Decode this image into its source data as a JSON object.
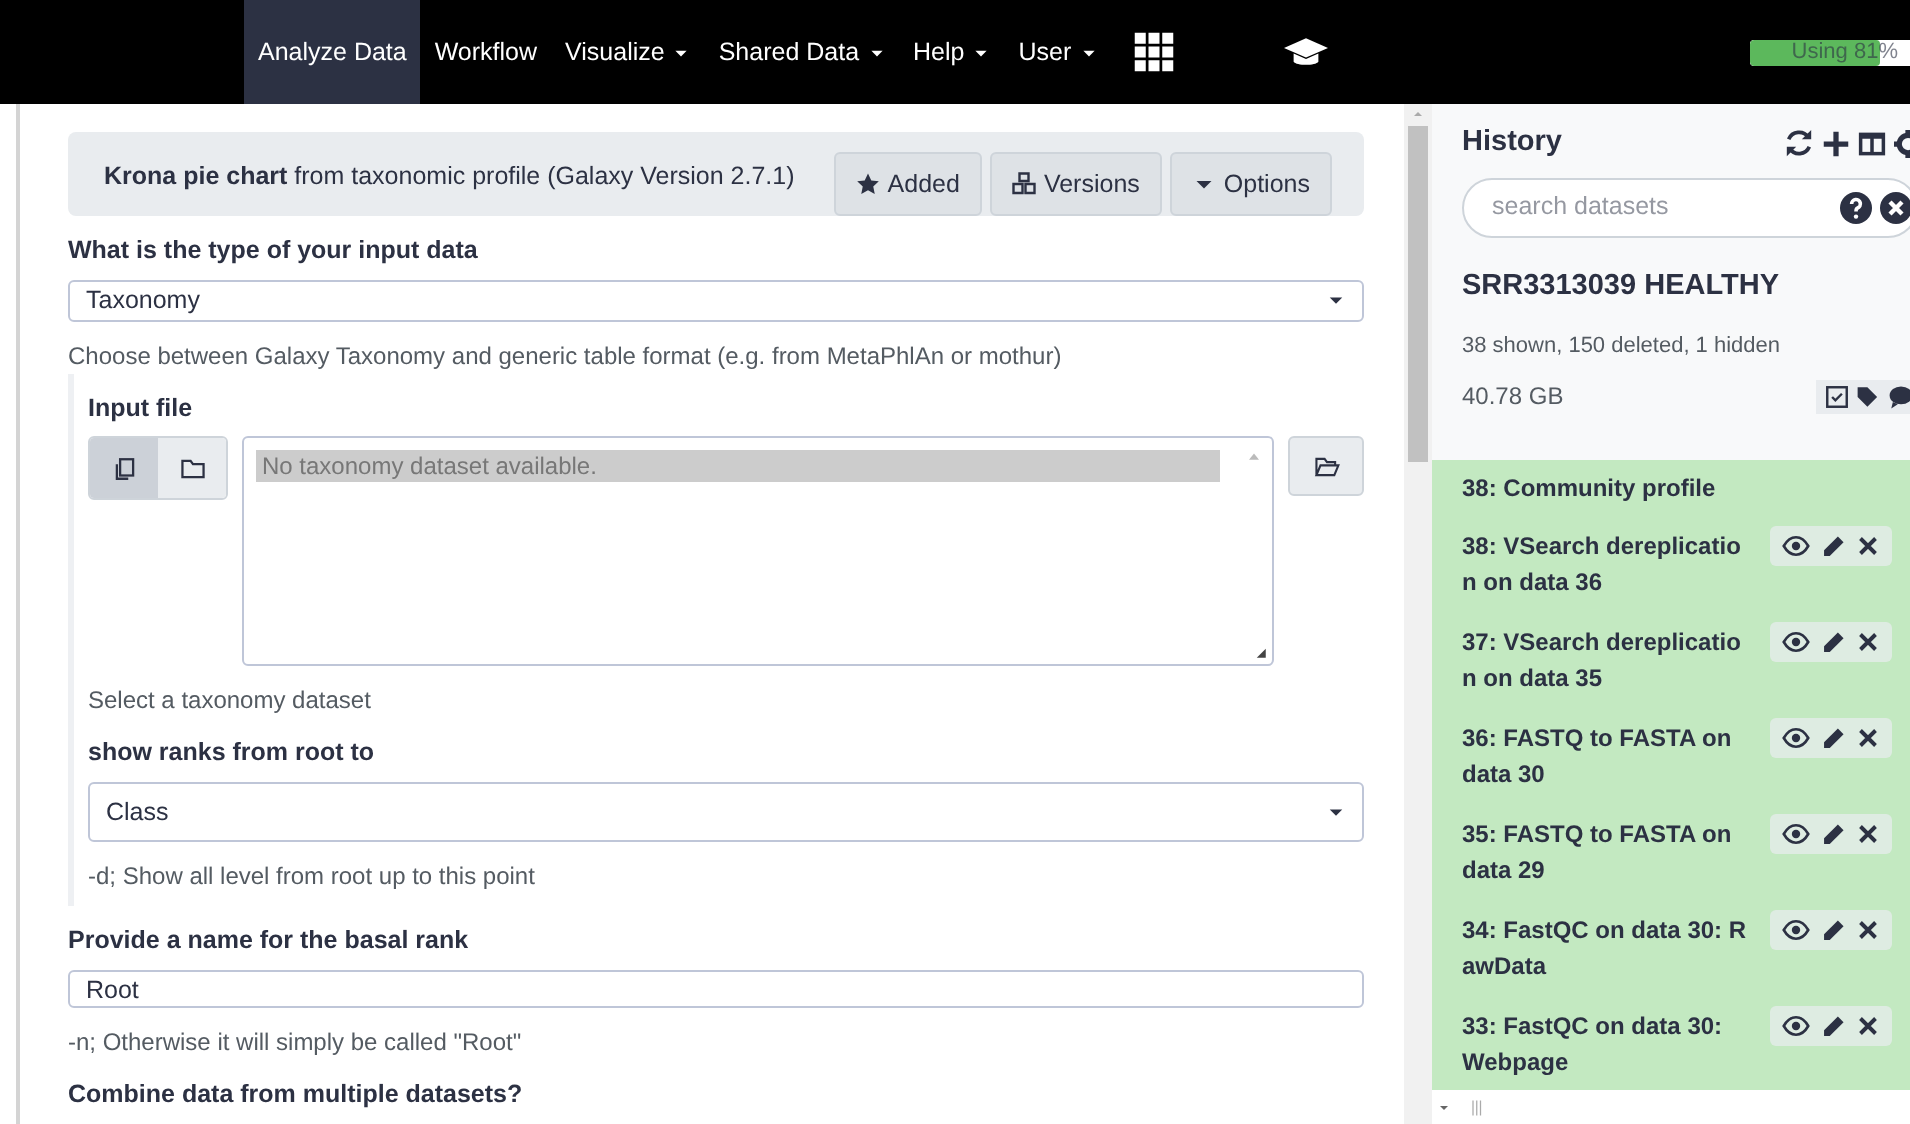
{
  "nav": {
    "items": [
      {
        "label": "Analyze Data",
        "selected": true,
        "dropdown": false
      },
      {
        "label": "Workflow",
        "selected": false,
        "dropdown": false
      },
      {
        "label": "Visualize",
        "selected": false,
        "dropdown": true
      },
      {
        "label": "Shared Data",
        "selected": false,
        "dropdown": true
      },
      {
        "label": "Help",
        "selected": false,
        "dropdown": true
      },
      {
        "label": "User",
        "selected": false,
        "dropdown": true
      }
    ],
    "quota": {
      "label": "Using 81%",
      "level": 0.81
    }
  },
  "tool": {
    "name": "Krona pie chart",
    "description": "from taxonomic profile (Galaxy Version 2.7.1)",
    "buttons": [
      {
        "label": "Added",
        "kind": "star"
      },
      {
        "label": "Versions",
        "kind": "cubes"
      },
      {
        "label": "Options",
        "kind": "caret"
      }
    ]
  },
  "form": [
    {
      "kind": "select",
      "label": "What is the type of your input data",
      "value": "Taxonomy",
      "help": "Choose between Galaxy Taxonomy and generic table format (e.g. from MetaPhlAn or mothur)"
    },
    {
      "kind": "section",
      "children": [
        {
          "kind": "dataset",
          "label": "Input file",
          "placeholder": "No taxonomy dataset available.",
          "help": "Select a taxonomy dataset"
        },
        {
          "kind": "select",
          "label": "show ranks from root to",
          "value": "Class",
          "help": "-d; Show all level from root up to this point"
        }
      ]
    },
    {
      "kind": "text",
      "label": "Provide a name for the basal rank",
      "value": "Root",
      "help": "-n; Otherwise it will simply be called \"Root\""
    },
    {
      "kind": "heading",
      "label": "Combine data from multiple datasets?"
    }
  ],
  "history": {
    "title": "History",
    "search_placeholder": "search datasets",
    "name": "SRR3313039 HEALTHY",
    "summary": "38 shown, 150 deleted, 1 hidden",
    "size": "40.78 GB",
    "items": [
      {
        "title": "38: Community profile",
        "kind": "partial"
      },
      {
        "title": "38: VSearch dereplication on data 36",
        "kind": "dataset"
      },
      {
        "title": "37: VSearch dereplication on data 35",
        "kind": "dataset"
      },
      {
        "title": "36: FASTQ to FASTA on data 30",
        "kind": "dataset"
      },
      {
        "title": "35: FASTQ to FASTA on data 29",
        "kind": "dataset"
      },
      {
        "title": "34: FastQC on data 30: RawData",
        "kind": "dataset"
      },
      {
        "title": "33: FastQC on data 30: Webpage",
        "kind": "dataset"
      }
    ]
  }
}
